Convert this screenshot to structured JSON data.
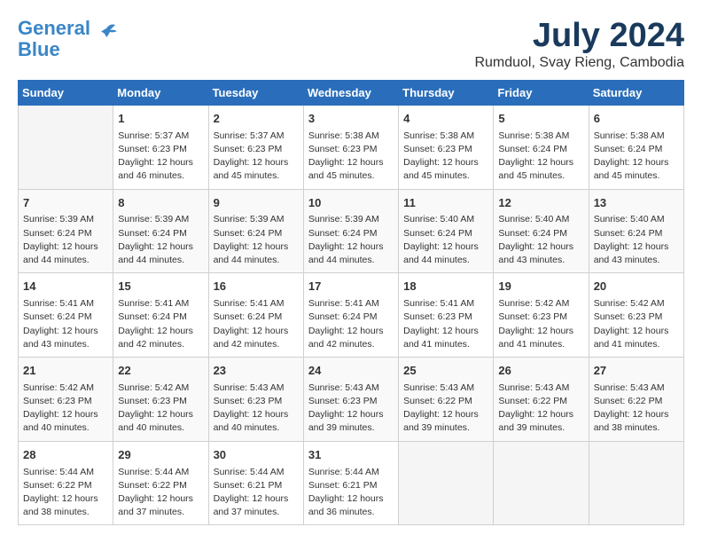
{
  "logo": {
    "general": "General",
    "blue": "Blue"
  },
  "title": {
    "month_year": "July 2024",
    "location": "Rumduol, Svay Rieng, Cambodia"
  },
  "days_header": [
    "Sunday",
    "Monday",
    "Tuesday",
    "Wednesday",
    "Thursday",
    "Friday",
    "Saturday"
  ],
  "weeks": [
    [
      {
        "day": "",
        "content": ""
      },
      {
        "day": "1",
        "content": "Sunrise: 5:37 AM\nSunset: 6:23 PM\nDaylight: 12 hours\nand 46 minutes."
      },
      {
        "day": "2",
        "content": "Sunrise: 5:37 AM\nSunset: 6:23 PM\nDaylight: 12 hours\nand 45 minutes."
      },
      {
        "day": "3",
        "content": "Sunrise: 5:38 AM\nSunset: 6:23 PM\nDaylight: 12 hours\nand 45 minutes."
      },
      {
        "day": "4",
        "content": "Sunrise: 5:38 AM\nSunset: 6:23 PM\nDaylight: 12 hours\nand 45 minutes."
      },
      {
        "day": "5",
        "content": "Sunrise: 5:38 AM\nSunset: 6:24 PM\nDaylight: 12 hours\nand 45 minutes."
      },
      {
        "day": "6",
        "content": "Sunrise: 5:38 AM\nSunset: 6:24 PM\nDaylight: 12 hours\nand 45 minutes."
      }
    ],
    [
      {
        "day": "7",
        "content": "Sunrise: 5:39 AM\nSunset: 6:24 PM\nDaylight: 12 hours\nand 44 minutes."
      },
      {
        "day": "8",
        "content": "Sunrise: 5:39 AM\nSunset: 6:24 PM\nDaylight: 12 hours\nand 44 minutes."
      },
      {
        "day": "9",
        "content": "Sunrise: 5:39 AM\nSunset: 6:24 PM\nDaylight: 12 hours\nand 44 minutes."
      },
      {
        "day": "10",
        "content": "Sunrise: 5:39 AM\nSunset: 6:24 PM\nDaylight: 12 hours\nand 44 minutes."
      },
      {
        "day": "11",
        "content": "Sunrise: 5:40 AM\nSunset: 6:24 PM\nDaylight: 12 hours\nand 44 minutes."
      },
      {
        "day": "12",
        "content": "Sunrise: 5:40 AM\nSunset: 6:24 PM\nDaylight: 12 hours\nand 43 minutes."
      },
      {
        "day": "13",
        "content": "Sunrise: 5:40 AM\nSunset: 6:24 PM\nDaylight: 12 hours\nand 43 minutes."
      }
    ],
    [
      {
        "day": "14",
        "content": "Sunrise: 5:41 AM\nSunset: 6:24 PM\nDaylight: 12 hours\nand 43 minutes."
      },
      {
        "day": "15",
        "content": "Sunrise: 5:41 AM\nSunset: 6:24 PM\nDaylight: 12 hours\nand 42 minutes."
      },
      {
        "day": "16",
        "content": "Sunrise: 5:41 AM\nSunset: 6:24 PM\nDaylight: 12 hours\nand 42 minutes."
      },
      {
        "day": "17",
        "content": "Sunrise: 5:41 AM\nSunset: 6:24 PM\nDaylight: 12 hours\nand 42 minutes."
      },
      {
        "day": "18",
        "content": "Sunrise: 5:41 AM\nSunset: 6:23 PM\nDaylight: 12 hours\nand 41 minutes."
      },
      {
        "day": "19",
        "content": "Sunrise: 5:42 AM\nSunset: 6:23 PM\nDaylight: 12 hours\nand 41 minutes."
      },
      {
        "day": "20",
        "content": "Sunrise: 5:42 AM\nSunset: 6:23 PM\nDaylight: 12 hours\nand 41 minutes."
      }
    ],
    [
      {
        "day": "21",
        "content": "Sunrise: 5:42 AM\nSunset: 6:23 PM\nDaylight: 12 hours\nand 40 minutes."
      },
      {
        "day": "22",
        "content": "Sunrise: 5:42 AM\nSunset: 6:23 PM\nDaylight: 12 hours\nand 40 minutes."
      },
      {
        "day": "23",
        "content": "Sunrise: 5:43 AM\nSunset: 6:23 PM\nDaylight: 12 hours\nand 40 minutes."
      },
      {
        "day": "24",
        "content": "Sunrise: 5:43 AM\nSunset: 6:23 PM\nDaylight: 12 hours\nand 39 minutes."
      },
      {
        "day": "25",
        "content": "Sunrise: 5:43 AM\nSunset: 6:22 PM\nDaylight: 12 hours\nand 39 minutes."
      },
      {
        "day": "26",
        "content": "Sunrise: 5:43 AM\nSunset: 6:22 PM\nDaylight: 12 hours\nand 39 minutes."
      },
      {
        "day": "27",
        "content": "Sunrise: 5:43 AM\nSunset: 6:22 PM\nDaylight: 12 hours\nand 38 minutes."
      }
    ],
    [
      {
        "day": "28",
        "content": "Sunrise: 5:44 AM\nSunset: 6:22 PM\nDaylight: 12 hours\nand 38 minutes."
      },
      {
        "day": "29",
        "content": "Sunrise: 5:44 AM\nSunset: 6:22 PM\nDaylight: 12 hours\nand 37 minutes."
      },
      {
        "day": "30",
        "content": "Sunrise: 5:44 AM\nSunset: 6:21 PM\nDaylight: 12 hours\nand 37 minutes."
      },
      {
        "day": "31",
        "content": "Sunrise: 5:44 AM\nSunset: 6:21 PM\nDaylight: 12 hours\nand 36 minutes."
      },
      {
        "day": "",
        "content": ""
      },
      {
        "day": "",
        "content": ""
      },
      {
        "day": "",
        "content": ""
      }
    ]
  ]
}
